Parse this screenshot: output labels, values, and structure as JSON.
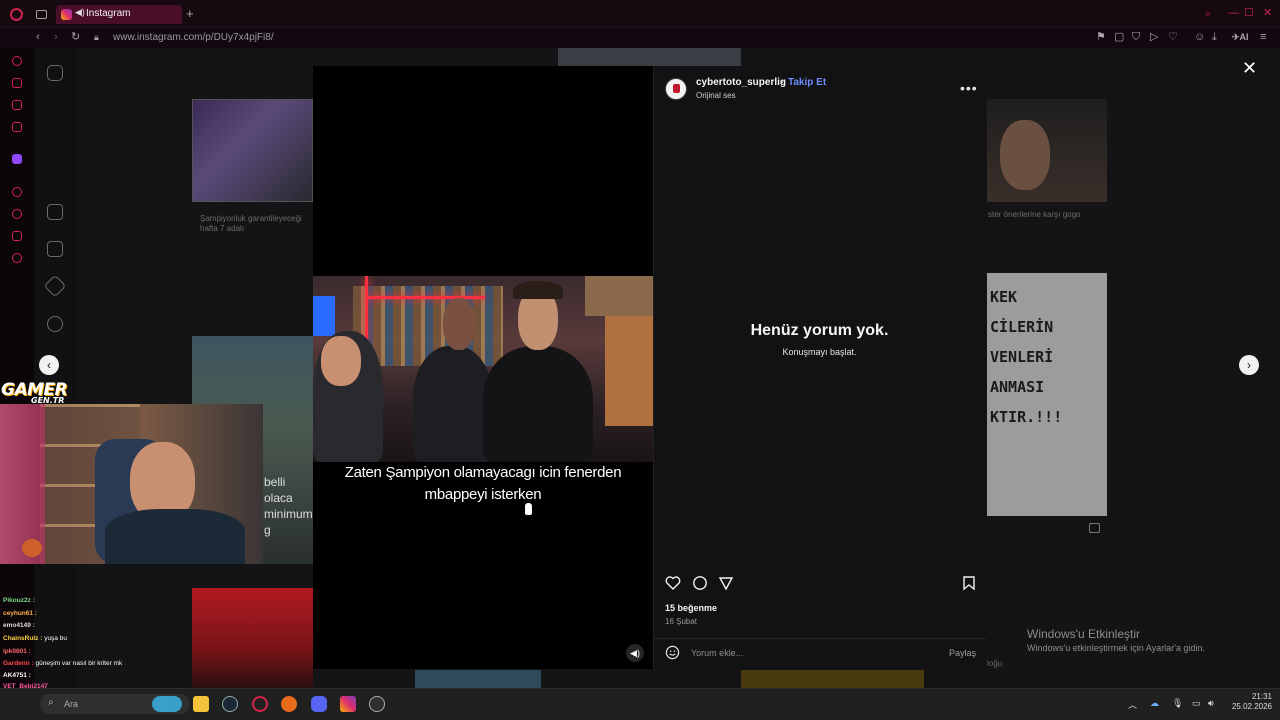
{
  "browser": {
    "tab_title": "Instagram",
    "new_tab": "+",
    "url": "www.instagram.com/p/DUy7x4pjFi8/",
    "ai_label": "AI"
  },
  "post": {
    "username": "cybertoto_superlig",
    "separator": "•",
    "follow_label": "Takip Et",
    "audio_label": "Orijinal ses",
    "more_label": "•••",
    "no_comments_title": "Henüz yorum yok.",
    "no_comments_sub": "Konuşmayı başlat.",
    "likes": "15 beğenme",
    "date": "16 Şubat",
    "comment_placeholder": "Yorum ekle...",
    "share_label": "Paylaş",
    "subtitle_line1": "Zaten Şampiyon olamayacagı icin fenerden",
    "subtitle_line2": "mbappeyi isterken"
  },
  "background": {
    "caption_left": "Şampiyonluk garantileyeceği hafta 7 adalı",
    "caption_right": "ster önerilerine karşı gogo",
    "poster_lines": [
      "KEK",
      "CİLERİN",
      "VENLERİ",
      "ANMASI",
      "KTIR.!!!"
    ],
    "caption_mid": "belli olaca minimum g",
    "caption_bottom_right": "loğu"
  },
  "overlay": {
    "close_label": "✕",
    "prev_label": "‹",
    "next_label": "›",
    "gamer_logo_main": "GAMER",
    "gamer_logo_sub": "GEN.TR"
  },
  "chat": [
    {
      "user": "Pikouz2z :",
      "msg": ""
    },
    {
      "user": "ceyhun61 :",
      "msg": ""
    },
    {
      "user": "emo4149 :",
      "msg": ""
    },
    {
      "user": "ChainsRulz :",
      "msg": "yuşa bu"
    },
    {
      "user": "ipk0601 :",
      "msg": ""
    },
    {
      "user": "Gardenn :",
      "msg": "güneşim var nasıl bir kriter mk"
    },
    {
      "user": "AK4751 :",
      "msg": ""
    },
    {
      "user": "VET_Bebi2147",
      "msg": ""
    }
  ],
  "windows": {
    "activate_title": "Windows'u Etkinleştir",
    "activate_sub": "Windows'u etkinleştirmek için Ayarlar'a gidin.",
    "search_label": "Ara",
    "time": "21:31",
    "date": "25.02.2026"
  }
}
